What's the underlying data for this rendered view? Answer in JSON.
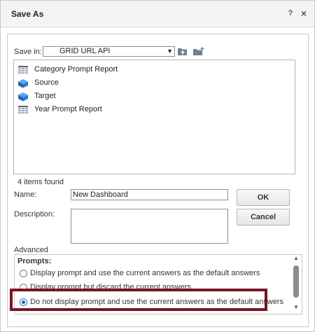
{
  "dialog": {
    "title": "Save As",
    "help_glyph": "?",
    "close_glyph": "×"
  },
  "save_in": {
    "label": "Save in:",
    "value": "GRID URL API"
  },
  "files": [
    {
      "label": "Category Prompt Report",
      "icon": "grid-report-icon"
    },
    {
      "label": "Source",
      "icon": "cube-icon"
    },
    {
      "label": "Target",
      "icon": "cube-icon"
    },
    {
      "label": "Year Prompt Report",
      "icon": "grid-report-icon"
    }
  ],
  "status": "4 items found",
  "name": {
    "label": "Name:",
    "value": "New Dashboard"
  },
  "description": {
    "label": "Description:",
    "value": ""
  },
  "buttons": {
    "ok": "OK",
    "cancel": "Cancel"
  },
  "advanced": {
    "label": "Advanced",
    "prompts_label": "Prompts:",
    "options": [
      {
        "label": "Display prompt and use the current answers as the default answers",
        "selected": false
      },
      {
        "label": "Display prompt but discard the current answers",
        "selected": false
      },
      {
        "label": "Do not display prompt and use the current answers as the default answers",
        "selected": true
      }
    ]
  },
  "colors": {
    "highlight": "#7a1424",
    "radio_selected": "#1a5fc4",
    "cube_blue": "#2a7bd1"
  }
}
